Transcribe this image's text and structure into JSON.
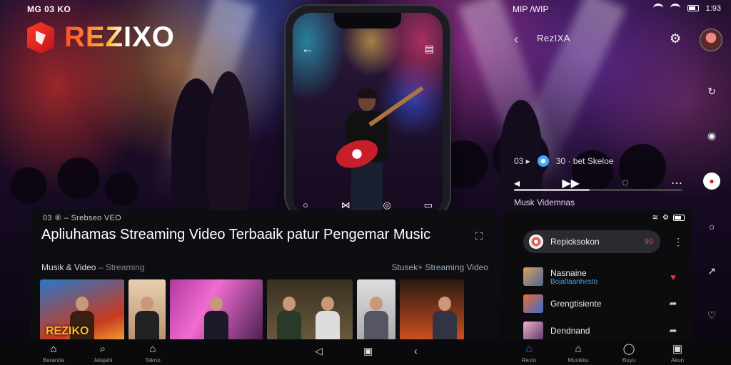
{
  "status": {
    "left_time": "MG 03 KO",
    "center_text": "MIP /WIP",
    "right_time": "1:93"
  },
  "brand": {
    "name": "REZIXO"
  },
  "phone": {
    "back_icon": "arrow-left-icon",
    "menu_icon": "phone-menu-icon",
    "controls": [
      "○",
      "⋈",
      "◎",
      "▭"
    ]
  },
  "player": {
    "back_icon": "chevron-left-icon",
    "title": "RezIXA",
    "track_info": "03  ▸",
    "track_meta": "30 · bet Skeloe",
    "progress": 0.45,
    "caption": "Musk Videmnas",
    "controls": [
      "◂",
      "▶▶",
      "◌",
      "⋯"
    ]
  },
  "rail": {
    "items": [
      "↻",
      "◉",
      "●",
      "○",
      "↗",
      "♡"
    ]
  },
  "panel": {
    "meta": "03 ⑧ – Srebseo VEO",
    "title": "Apliuhamas Streaming Video Terbaaik patur Pengemar Music",
    "expand_icon": "expand-icon",
    "sub_left": "Musik & Video",
    "sub_left_muted": "Streaming",
    "link": "Stusek+ Streaming Video",
    "thumb_logo": "REZIKO"
  },
  "rpanel": {
    "search_text": "Repicksokon",
    "search_tag": "90",
    "items": [
      {
        "title": "Nasnaine",
        "sub": "Bojaltaanhesto",
        "action": "♥"
      },
      {
        "title": "Grengtisiente",
        "sub": "",
        "action": "➦"
      },
      {
        "title": "Dendnand",
        "sub": "",
        "action": "➦"
      }
    ]
  },
  "nav": {
    "left": [
      {
        "icon": "⌂",
        "label": "Beranda"
      },
      {
        "icon": "⌕",
        "label": "Jelajahi"
      },
      {
        "icon": "⌂",
        "label": "Tekno"
      }
    ],
    "system": [
      "◁",
      "▣",
      "‹"
    ],
    "right": [
      {
        "icon": "⌂",
        "label": "Rezio"
      },
      {
        "icon": "⌂",
        "label": "Musikku"
      },
      {
        "icon": "◯",
        "label": "Buyu"
      },
      {
        "icon": "▣",
        "label": "Akun"
      }
    ]
  },
  "colors": {
    "accent": "#3d6cff",
    "brand_red": "#e02a20",
    "brand_orange": "#ffb833"
  }
}
